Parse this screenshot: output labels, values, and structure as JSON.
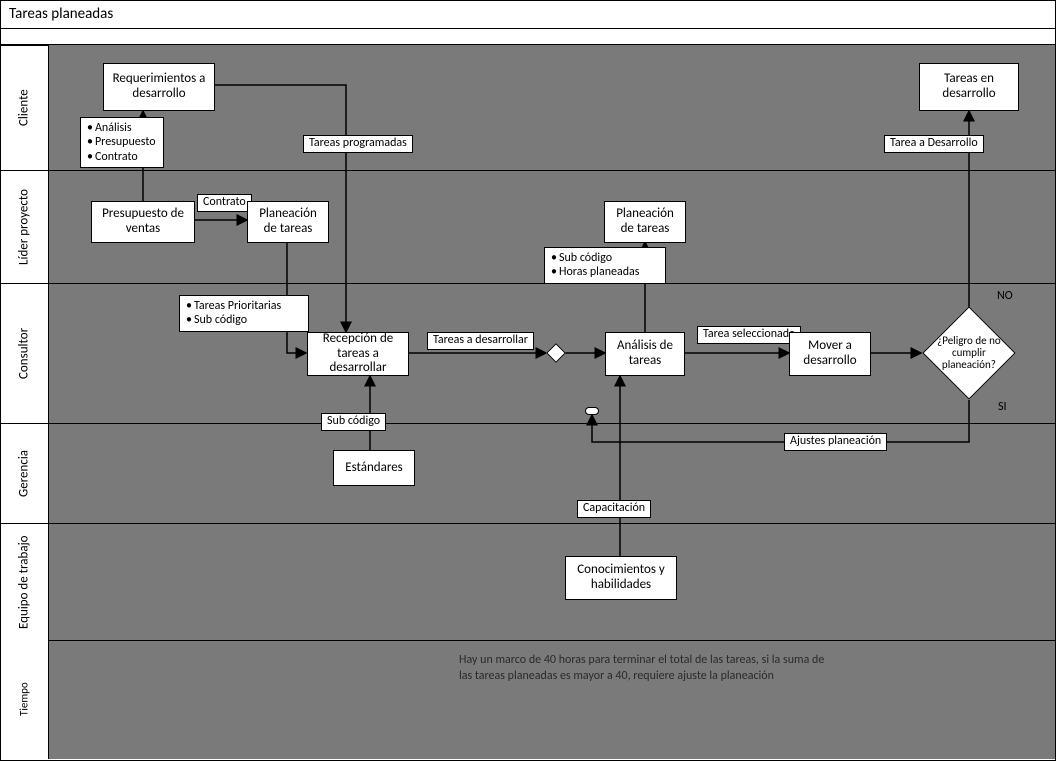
{
  "title": "Tareas planeadas",
  "lanes": {
    "l1": "Cliente",
    "l2": "Líder proyecto",
    "l3": "Consultor",
    "l4": "Gerencia",
    "l5": "Equipo de trabajo",
    "l6": "Tiempo"
  },
  "boxes": {
    "req": "Requerimientos a desarrollo",
    "tareasDev": "Tareas en desarrollo",
    "presupuesto": "Presupuesto de ventas",
    "planeacion1": "Planeación de tareas",
    "planeacion2": "Planeación de tareas",
    "recepcion": "Recepción de tareas a desarrollar",
    "analisis": "Análisis de tareas",
    "mover": "Mover a desarrollo",
    "estandares": "Estándares",
    "conocimientos": "Conocimientos y habilidades"
  },
  "bullets": {
    "apc": {
      "a": "Análisis",
      "b": "Presupuesto",
      "c": "Contrato"
    },
    "tp": {
      "a": "Tareas Prioritarias",
      "b": "Sub código"
    },
    "sh": {
      "a": "Sub código",
      "b": "Horas planeadas"
    }
  },
  "labels": {
    "contrato": "Contrato",
    "tareasProg": "Tareas programadas",
    "tareaADev": "Tarea a Desarrollo",
    "tareasADes": "Tareas a desarrollar",
    "tareaSel": "Tarea seleccionada",
    "subcodigo": "Sub código",
    "capacitacion": "Capacitación",
    "ajustes": "Ajustes planeación",
    "no": "NO",
    "si": "SI"
  },
  "decision": "¿Peligro de no cumplir planeación?",
  "note": "Hay un marco de 40 horas para terminar el total de las tareas, si la suma de las tareas planeadas es mayor a 40, requiere ajuste la planeación",
  "chart_data": {
    "type": "flowchart",
    "title": "Tareas planeadas",
    "swimlanes": [
      "Cliente",
      "Líder proyecto",
      "Consultor",
      "Gerencia",
      "Equipo de trabajo",
      "Tiempo"
    ],
    "nodes": [
      {
        "id": "req",
        "lane": "Cliente",
        "type": "process",
        "label": "Requerimientos a desarrollo"
      },
      {
        "id": "tareasDev",
        "lane": "Cliente",
        "type": "process",
        "label": "Tareas en desarrollo"
      },
      {
        "id": "presupuesto",
        "lane": "Líder proyecto",
        "type": "process",
        "label": "Presupuesto de ventas"
      },
      {
        "id": "planeacion1",
        "lane": "Líder proyecto",
        "type": "process",
        "label": "Planeación de tareas"
      },
      {
        "id": "planeacion2",
        "lane": "Líder proyecto",
        "type": "process",
        "label": "Planeación de tareas"
      },
      {
        "id": "recepcion",
        "lane": "Consultor",
        "type": "process",
        "label": "Recepción de tareas a desarrollar"
      },
      {
        "id": "analisis",
        "lane": "Consultor",
        "type": "process",
        "label": "Análisis de tareas"
      },
      {
        "id": "mover",
        "lane": "Consultor",
        "type": "process",
        "label": "Mover a desarrollo"
      },
      {
        "id": "decision",
        "lane": "Consultor",
        "type": "decision",
        "label": "¿Peligro de no cumplir planeación?"
      },
      {
        "id": "estandares",
        "lane": "Gerencia",
        "type": "process",
        "label": "Estándares"
      },
      {
        "id": "conocimientos",
        "lane": "Equipo de trabajo",
        "type": "process",
        "label": "Conocimientos y habilidades"
      }
    ],
    "edges": [
      {
        "from": "presupuesto",
        "to": "req",
        "label": "",
        "data": [
          "Análisis",
          "Presupuesto",
          "Contrato"
        ]
      },
      {
        "from": "presupuesto",
        "to": "planeacion1",
        "label": "Contrato"
      },
      {
        "from": "req",
        "to": "recepcion",
        "label": "Tareas programadas"
      },
      {
        "from": "planeacion1",
        "to": "recepcion",
        "label": "",
        "data": [
          "Tareas Prioritarias",
          "Sub código"
        ]
      },
      {
        "from": "estandares",
        "to": "recepcion",
        "label": "Sub código"
      },
      {
        "from": "recepcion",
        "to": "analisis",
        "label": "Tareas a desarrollar"
      },
      {
        "from": "analisis",
        "to": "planeacion2",
        "label": "",
        "data": [
          "Sub código",
          "Horas planeadas"
        ]
      },
      {
        "from": "conocimientos",
        "to": "analisis",
        "label": "Capacitación"
      },
      {
        "from": "analisis",
        "to": "mover",
        "label": "Tarea seleccionada"
      },
      {
        "from": "mover",
        "to": "decision",
        "label": ""
      },
      {
        "from": "decision",
        "to": "tareasDev",
        "label": "NO",
        "data": [
          "Tarea a Desarrollo"
        ]
      },
      {
        "from": "decision",
        "to": "analisis",
        "label": "SI",
        "data": [
          "Ajustes planeación"
        ]
      }
    ],
    "note": {
      "lane": "Tiempo",
      "text": "Hay un marco de 40 horas para terminar el total de las tareas, si la suma de las tareas planeadas es mayor a 40, requiere ajuste la planeación"
    }
  }
}
